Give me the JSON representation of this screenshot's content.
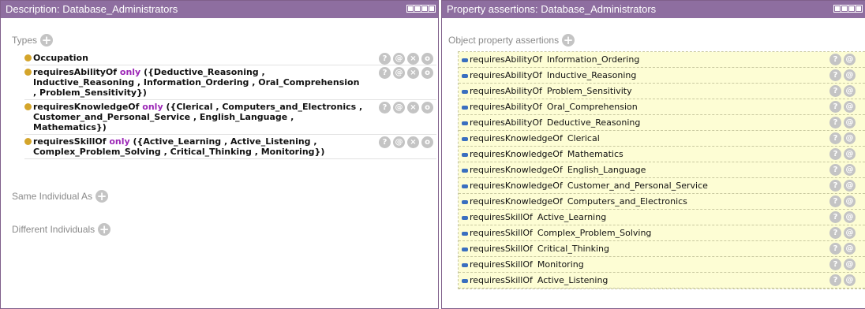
{
  "left_panel": {
    "title": "Description: Database_Administrators",
    "types_label": "Types",
    "types": [
      {
        "segments": [
          {
            "text": "Occupation",
            "kw": false
          }
        ]
      },
      {
        "segments": [
          {
            "text": "requiresAbilityOf ",
            "kw": false
          },
          {
            "text": "only",
            "kw": true
          },
          {
            "text": " ({Deductive_Reasoning , Inductive_Reasoning , Information_Ordering , Oral_Comprehension , Problem_Sensitivity})",
            "kw": false
          }
        ]
      },
      {
        "segments": [
          {
            "text": "requiresKnowledgeOf ",
            "kw": false
          },
          {
            "text": "only",
            "kw": true
          },
          {
            "text": " ({Clerical , Computers_and_Electronics , Customer_and_Personal_Service , English_Language , Mathematics})",
            "kw": false
          }
        ]
      },
      {
        "segments": [
          {
            "text": "requiresSkillOf ",
            "kw": false
          },
          {
            "text": "only",
            "kw": true
          },
          {
            "text": " ({Active_Learning , Active_Listening , Complex_Problem_Solving , Critical_Thinking , Monitoring})",
            "kw": false
          }
        ]
      }
    ],
    "same_individual_label": "Same Individual As",
    "different_individuals_label": "Different Individuals"
  },
  "right_panel": {
    "title": "Property assertions: Database_Administrators",
    "object_assertions_label": "Object property assertions",
    "assertions": [
      {
        "property": "requiresAbilityOf",
        "value": "Information_Ordering"
      },
      {
        "property": "requiresAbilityOf",
        "value": "Inductive_Reasoning"
      },
      {
        "property": "requiresAbilityOf",
        "value": "Problem_Sensitivity"
      },
      {
        "property": "requiresAbilityOf",
        "value": "Oral_Comprehension"
      },
      {
        "property": "requiresAbilityOf",
        "value": "Deductive_Reasoning"
      },
      {
        "property": "requiresKnowledgeOf",
        "value": "Clerical"
      },
      {
        "property": "requiresKnowledgeOf",
        "value": "Mathematics"
      },
      {
        "property": "requiresKnowledgeOf",
        "value": "English_Language"
      },
      {
        "property": "requiresKnowledgeOf",
        "value": "Customer_and_Personal_Service"
      },
      {
        "property": "requiresKnowledgeOf",
        "value": "Computers_and_Electronics"
      },
      {
        "property": "requiresSkillOf",
        "value": "Active_Learning"
      },
      {
        "property": "requiresSkillOf",
        "value": "Complex_Problem_Solving"
      },
      {
        "property": "requiresSkillOf",
        "value": "Critical_Thinking"
      },
      {
        "property": "requiresSkillOf",
        "value": "Monitoring"
      },
      {
        "property": "requiresSkillOf",
        "value": "Active_Listening"
      }
    ]
  },
  "icons": {
    "add": "+",
    "help": "?",
    "annotate": "@",
    "delete": "×",
    "edit": "o"
  },
  "colors": {
    "titlebar": "#8e6ea0",
    "keyword": "#9b26b6",
    "type_dot": "#d4a52b",
    "assertion_bg": "#fdfdd4",
    "object_property_bar": "#3a6fbf"
  }
}
